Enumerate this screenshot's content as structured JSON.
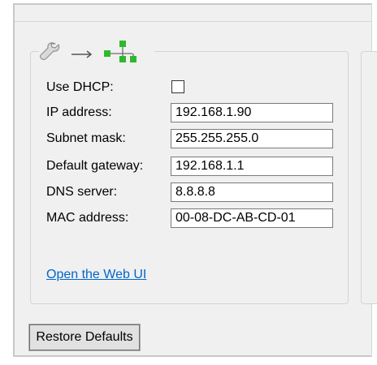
{
  "header": {
    "tool_icon": "wrench-icon",
    "arrow_icon": "right-arrow-icon",
    "network_icon": "network-tree-icon",
    "network_icon_color": "#2eb82e"
  },
  "form": {
    "use_dhcp": {
      "label": "Use DHCP:",
      "checked": false
    },
    "ip_address": {
      "label": "IP address:",
      "value": "192.168.1.90"
    },
    "subnet_mask": {
      "label": "Subnet mask:",
      "value": "255.255.255.0"
    },
    "default_gateway": {
      "label": "Default gateway:",
      "value": "192.168.1.1"
    },
    "dns_server": {
      "label": "DNS server:",
      "value": "8.8.8.8"
    },
    "mac_address": {
      "label": "MAC address:",
      "value": "00-08-DC-AB-CD-01"
    }
  },
  "links": {
    "open_web_ui": "Open the Web UI"
  },
  "buttons": {
    "restore_defaults": "Restore Defaults"
  },
  "colors": {
    "link": "#0066cc",
    "window_background": "#f0f0f0"
  }
}
